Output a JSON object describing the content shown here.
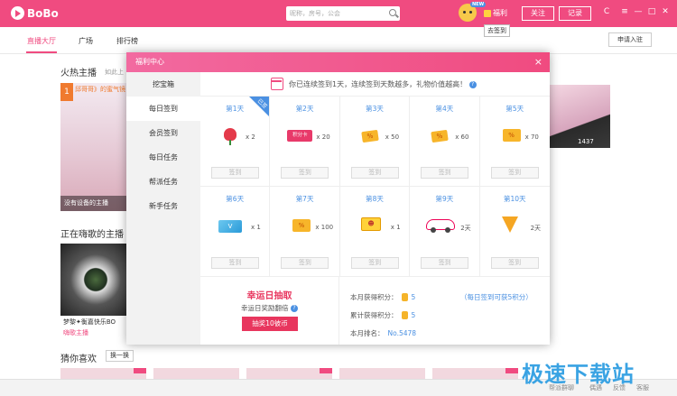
{
  "app": {
    "name": "BoBo"
  },
  "topbar": {
    "search_placeholder": "昵称，房号，公会",
    "welfare_label": "福利",
    "new_badge": "NEW",
    "tooltip": "去签到",
    "follow_label": "关注",
    "record_label": "记录",
    "window_controls": [
      "C",
      "≡",
      "—",
      "□",
      "✕"
    ]
  },
  "nav": {
    "tabs": [
      "直播大厅",
      "广场",
      "排行榜"
    ],
    "apply_label": "申请入驻"
  },
  "background": {
    "hot_title": "火热主播",
    "hot_subtitle": "如此上",
    "rank_flag": "1",
    "top_label": "邱哥哥》的蜜气镜",
    "hot_caption": "没有设备的主播",
    "right_count": "1437",
    "sing_title": "正在嗨歌的主播",
    "sing_name": "梦黎✦衡嘉快乐BO",
    "sing_tag": "嗨歌主播",
    "guess_title": "猜你喜欢",
    "refresh_label": "换一换"
  },
  "status_bar": {
    "items": [
      "帮派群聊",
      "偶遇",
      "反馈",
      "客服"
    ]
  },
  "watermark": "极速下载站",
  "modal": {
    "title": "福利中心",
    "close_icon": "×",
    "sidebar": [
      "挖宝箱",
      "每日签到",
      "会员签到",
      "每日任务",
      "帮派任务",
      "新手任务"
    ],
    "sidebar_active": 1,
    "notice": "你已连续签到1天，连续签到天数越多，礼物价值越高！",
    "help": "?",
    "ribbon": "已签",
    "sign_label": "签到",
    "days": [
      {
        "label": "第1天",
        "qty": "x 2",
        "icon": "rose-icon"
      },
      {
        "label": "第2天",
        "qty": "x 20",
        "icon": "points-card-icon",
        "icon_text": "积分卡"
      },
      {
        "label": "第3天",
        "qty": "x 50",
        "icon": "coupon-icon",
        "icon_text": "%"
      },
      {
        "label": "第4天",
        "qty": "x 60",
        "icon": "coupon-icon",
        "icon_text": "%"
      },
      {
        "label": "第5天",
        "qty": "x 70",
        "icon": "coupon-icon",
        "icon_text": "%"
      },
      {
        "label": "第6天",
        "qty": "x 1",
        "icon": "vip-card-icon",
        "icon_text": "V"
      },
      {
        "label": "第7天",
        "qty": "x 100",
        "icon": "coupon-icon",
        "icon_text": "%"
      },
      {
        "label": "第8天",
        "qty": "x 1",
        "icon": "face-ticket-icon",
        "icon_text": "☻"
      },
      {
        "label": "第9天",
        "qty": "2天",
        "icon": "car-icon"
      },
      {
        "label": "第10天",
        "qty": "2天",
        "icon": "v-badge-icon"
      }
    ],
    "lottery": {
      "title": "幸运日抽取",
      "subtitle": "幸运日奖励翻倍",
      "button": "抽奖10彼币"
    },
    "stats": {
      "month_points_label": "本月获得积分：",
      "month_points": "5",
      "hint": "（每日签到可获5积分）",
      "total_points_label": "累计获得积分：",
      "total_points": "5",
      "rank_label": "本月排名：",
      "rank": "No.5478"
    }
  }
}
